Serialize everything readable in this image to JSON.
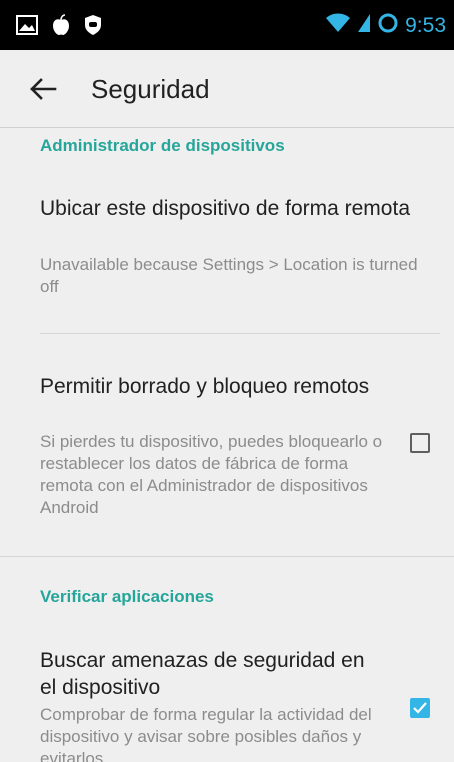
{
  "statusbar": {
    "time": "9:53",
    "icons": [
      "image-icon",
      "apple-icon",
      "shield-icon",
      "wifi-icon",
      "signal-icon",
      "sync-ring-icon"
    ],
    "time_color": "#33b5e5"
  },
  "appbar": {
    "title": "Seguridad",
    "back_icon": "back-arrow-icon"
  },
  "sections": [
    {
      "header": "Administrador de dispositivos",
      "items": [
        {
          "title": "Ubicar este dispositivo de forma remota",
          "summary": "Unavailable because Settings > Location is turned off"
        },
        {
          "title": "Permitir borrado y bloqueo remotos",
          "summary": "Si pierdes tu dispositivo, puedes bloquearlo o restablecer los datos de fábrica de forma remota con el Administrador de dispositivos Android",
          "checked": false
        }
      ]
    },
    {
      "header": "Verificar aplicaciones",
      "items": [
        {
          "title": "Buscar amenazas de seguridad en el dispositivo",
          "summary": "Comprobar de forma regular la actividad del dispositivo y avisar sobre posibles daños y evitarlos",
          "checked": true
        }
      ]
    }
  ],
  "colors": {
    "accent": "#26a69a",
    "checkbox_checked": "#33b5e5",
    "background": "#efefef"
  }
}
